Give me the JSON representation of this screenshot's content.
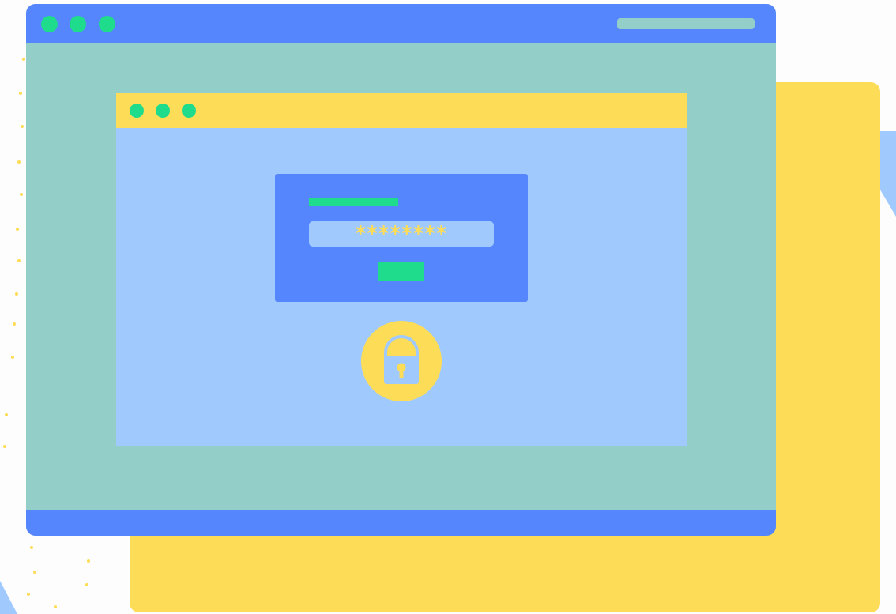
{
  "illustration": {
    "password_mask": "********",
    "icons": {
      "lock": "padlock-icon"
    },
    "colors": {
      "background": "#fdfdfd",
      "window_body": "#93cec8",
      "window_bar": "#5686fd",
      "window_dot": "#1fdc8d",
      "inner_body": "#a0cafe",
      "inner_bar": "#fddc58",
      "accent_yellow": "#fddc58",
      "accent_green": "#1fdc8d"
    }
  }
}
